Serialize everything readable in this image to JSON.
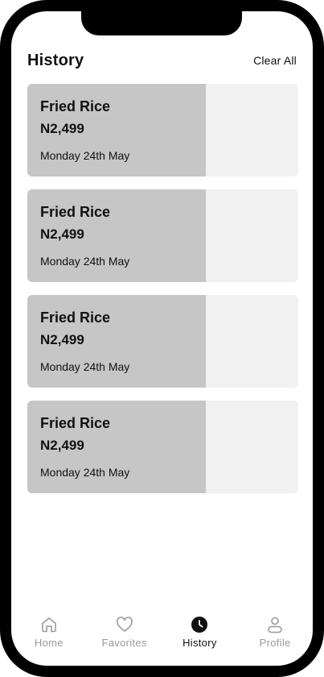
{
  "header": {
    "title": "History",
    "clear_label": "Clear All"
  },
  "history": [
    {
      "name": "Fried Rice",
      "price": "N2,499",
      "date": "Monday 24th May"
    },
    {
      "name": "Fried Rice",
      "price": "N2,499",
      "date": "Monday 24th May"
    },
    {
      "name": "Fried Rice",
      "price": "N2,499",
      "date": "Monday 24th May"
    },
    {
      "name": "Fried Rice",
      "price": "N2,499",
      "date": "Monday 24th May"
    }
  ],
  "tabbar": {
    "items": [
      {
        "label": "Home",
        "icon": "home-icon",
        "active": false
      },
      {
        "label": "Favorites",
        "icon": "heart-icon",
        "active": false
      },
      {
        "label": "History",
        "icon": "clock-icon",
        "active": true
      },
      {
        "label": "Profile",
        "icon": "user-icon",
        "active": false
      }
    ]
  },
  "colors": {
    "card_image": "#c6c6c6",
    "card_bg": "#f1f1f1",
    "active": "#111111",
    "inactive": "#9a9a9a"
  }
}
